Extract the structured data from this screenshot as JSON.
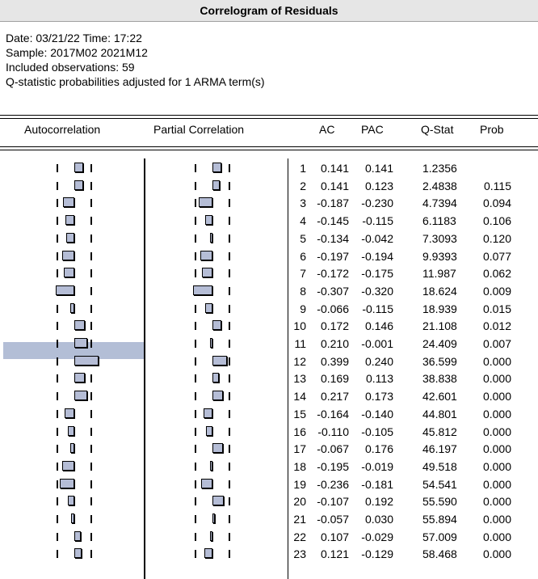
{
  "window": {
    "title": "Correlogram of Residuals"
  },
  "meta": {
    "date_line": "Date: 03/21/22   Time: 17:22",
    "sample_line": "Sample: 2017M02 2021M12",
    "obs_line": "Included observations: 59",
    "adj_line": "Q-statistic probabilities adjusted for 1 ARMA term(s)"
  },
  "headers": {
    "autocorrelation": "Autocorrelation",
    "partial": "Partial Correlation",
    "ac": "AC",
    "pac": "PAC",
    "qstat": "Q-Stat",
    "prob": "Prob"
  },
  "colors": {
    "bar": "#b5bdd6",
    "highlight": "#b3bed6"
  },
  "highlighted_row": 11,
  "rows": [
    {
      "lag": "1",
      "ac": "0.141",
      "pac": "0.141",
      "q": "1.2356",
      "prob": ""
    },
    {
      "lag": "2",
      "ac": "0.141",
      "pac": "0.123",
      "q": "2.4838",
      "prob": "0.115"
    },
    {
      "lag": "3",
      "ac": "-0.187",
      "pac": "-0.230",
      "q": "4.7394",
      "prob": "0.094"
    },
    {
      "lag": "4",
      "ac": "-0.145",
      "pac": "-0.115",
      "q": "6.1183",
      "prob": "0.106"
    },
    {
      "lag": "5",
      "ac": "-0.134",
      "pac": "-0.042",
      "q": "7.3093",
      "prob": "0.120"
    },
    {
      "lag": "6",
      "ac": "-0.197",
      "pac": "-0.194",
      "q": "9.9393",
      "prob": "0.077"
    },
    {
      "lag": "7",
      "ac": "-0.172",
      "pac": "-0.175",
      "q": "11.987",
      "prob": "0.062"
    },
    {
      "lag": "8",
      "ac": "-0.307",
      "pac": "-0.320",
      "q": "18.624",
      "prob": "0.009"
    },
    {
      "lag": "9",
      "ac": "-0.066",
      "pac": "-0.115",
      "q": "18.939",
      "prob": "0.015"
    },
    {
      "lag": "10",
      "ac": "0.172",
      "pac": "0.146",
      "q": "21.108",
      "prob": "0.012"
    },
    {
      "lag": "11",
      "ac": "0.210",
      "pac": "-0.001",
      "q": "24.409",
      "prob": "0.007"
    },
    {
      "lag": "12",
      "ac": "0.399",
      "pac": "0.240",
      "q": "36.599",
      "prob": "0.000"
    },
    {
      "lag": "13",
      "ac": "0.169",
      "pac": "0.113",
      "q": "38.838",
      "prob": "0.000"
    },
    {
      "lag": "14",
      "ac": "0.217",
      "pac": "0.173",
      "q": "42.601",
      "prob": "0.000"
    },
    {
      "lag": "15",
      "ac": "-0.164",
      "pac": "-0.140",
      "q": "44.801",
      "prob": "0.000"
    },
    {
      "lag": "16",
      "ac": "-0.110",
      "pac": "-0.105",
      "q": "45.812",
      "prob": "0.000"
    },
    {
      "lag": "17",
      "ac": "-0.067",
      "pac": "0.176",
      "q": "46.197",
      "prob": "0.000"
    },
    {
      "lag": "18",
      "ac": "-0.195",
      "pac": "-0.019",
      "q": "49.518",
      "prob": "0.000"
    },
    {
      "lag": "19",
      "ac": "-0.236",
      "pac": "-0.181",
      "q": "54.541",
      "prob": "0.000"
    },
    {
      "lag": "20",
      "ac": "-0.107",
      "pac": "0.192",
      "q": "55.590",
      "prob": "0.000"
    },
    {
      "lag": "21",
      "ac": "-0.057",
      "pac": "0.030",
      "q": "55.894",
      "prob": "0.000"
    },
    {
      "lag": "22",
      "ac": "0.107",
      "pac": "-0.029",
      "q": "57.009",
      "prob": "0.000"
    },
    {
      "lag": "23",
      "ac": "0.121",
      "pac": "-0.129",
      "q": "58.468",
      "prob": "0.000"
    }
  ]
}
